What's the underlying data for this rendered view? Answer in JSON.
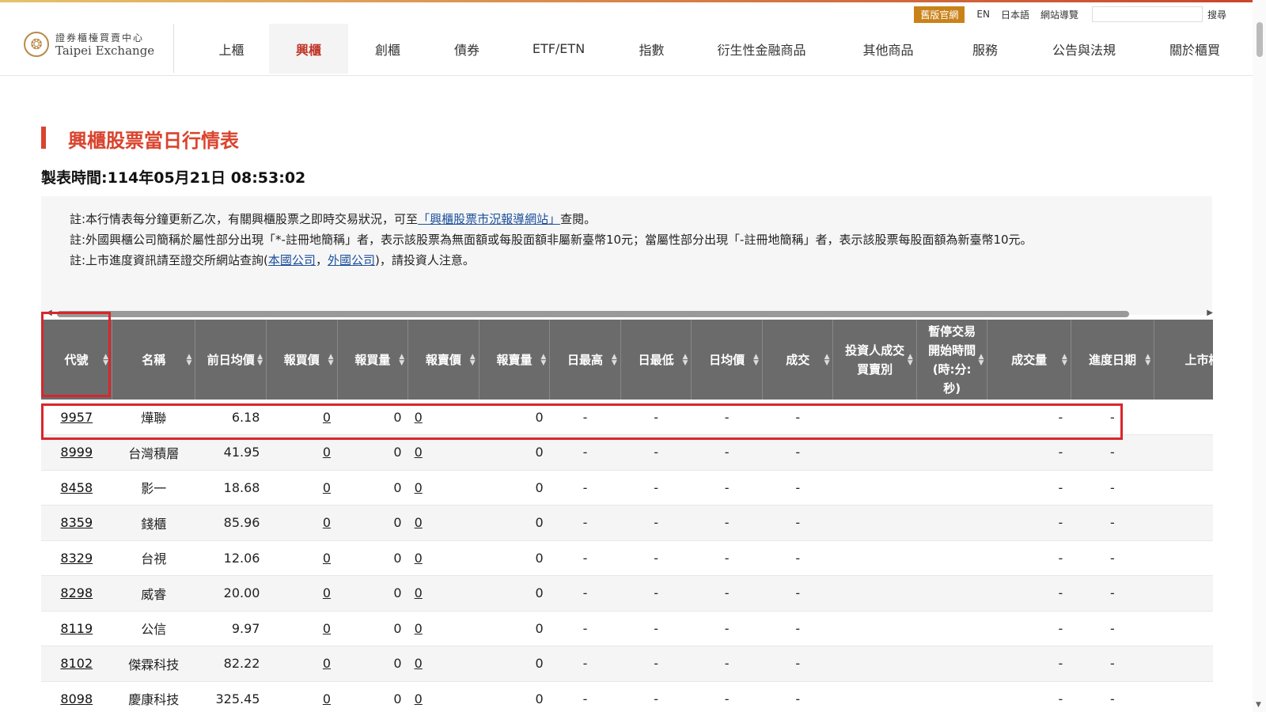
{
  "utilbar": {
    "old_site": "舊版官網",
    "links": [
      "EN",
      "日本語",
      "網站導覽"
    ],
    "search_label": "搜尋"
  },
  "logo": {
    "zh": "證券櫃檯買賣中心",
    "en": "Taipei Exchange"
  },
  "nav": {
    "items": [
      "上櫃",
      "興櫃",
      "創櫃",
      "債券",
      "ETF/ETN",
      "指數",
      "衍生性金融商品",
      "其他商品",
      "服務",
      "公告與法規",
      "關於櫃買"
    ],
    "active": "興櫃"
  },
  "page": {
    "title": "興櫃股票當日行情表",
    "timestamp": "製表時間:114年05月21日 08:53:02"
  },
  "notes": {
    "n1_pre": "註:本行情表每分鐘更新乙次，有關興櫃股票之即時交易狀況，可至",
    "n1_link": "「興櫃股票市況報導網站」",
    "n1_post": "查閱。",
    "n2": "註:外國興櫃公司簡稱於屬性部分出現「*-註冊地簡稱」者，表示該股票為無面額或每股面額非屬新臺幣10元；當屬性部分出現「-註冊地簡稱」者，表示該股票每股面額為新臺幣10元。",
    "n3_pre": "註:上市進度資訊請至證交所網站查詢(",
    "n3_link1": "本國公司",
    "n3_sep": "，",
    "n3_link2": "外國公司",
    "n3_post": ")，請投資人注意。"
  },
  "table": {
    "headers": [
      "代號",
      "名稱",
      "前日均價",
      "報買價",
      "報買量",
      "報賣價",
      "報賣量",
      "日最高",
      "日最低",
      "日均價",
      "成交",
      "投資人成交買賣別",
      "暫停交易開始時間(時:分:秒)",
      "成交量",
      "進度日期",
      "上市櫃進度"
    ],
    "rows": [
      {
        "code": "9957",
        "name": "燁聯",
        "prev": "6.18",
        "bid": "0",
        "bidv": "0",
        "ask": "0",
        "askv": "0",
        "high": "-",
        "low": "-",
        "avg": "-",
        "last": "-",
        "side": "",
        "halt": "",
        "vol": "-",
        "date": "-"
      },
      {
        "code": "8999",
        "name": "台灣積層",
        "prev": "41.95",
        "bid": "0",
        "bidv": "0",
        "ask": "0",
        "askv": "0",
        "high": "-",
        "low": "-",
        "avg": "-",
        "last": "-",
        "side": "",
        "halt": "",
        "vol": "-",
        "date": "-"
      },
      {
        "code": "8458",
        "name": "影一",
        "prev": "18.68",
        "bid": "0",
        "bidv": "0",
        "ask": "0",
        "askv": "0",
        "high": "-",
        "low": "-",
        "avg": "-",
        "last": "-",
        "side": "",
        "halt": "",
        "vol": "-",
        "date": "-"
      },
      {
        "code": "8359",
        "name": "錢櫃",
        "prev": "85.96",
        "bid": "0",
        "bidv": "0",
        "ask": "0",
        "askv": "0",
        "high": "-",
        "low": "-",
        "avg": "-",
        "last": "-",
        "side": "",
        "halt": "",
        "vol": "-",
        "date": "-"
      },
      {
        "code": "8329",
        "name": "台視",
        "prev": "12.06",
        "bid": "0",
        "bidv": "0",
        "ask": "0",
        "askv": "0",
        "high": "-",
        "low": "-",
        "avg": "-",
        "last": "-",
        "side": "",
        "halt": "",
        "vol": "-",
        "date": "-"
      },
      {
        "code": "8298",
        "name": "威睿",
        "prev": "20.00",
        "bid": "0",
        "bidv": "0",
        "ask": "0",
        "askv": "0",
        "high": "-",
        "low": "-",
        "avg": "-",
        "last": "-",
        "side": "",
        "halt": "",
        "vol": "-",
        "date": "-"
      },
      {
        "code": "8119",
        "name": "公信",
        "prev": "9.97",
        "bid": "0",
        "bidv": "0",
        "ask": "0",
        "askv": "0",
        "high": "-",
        "low": "-",
        "avg": "-",
        "last": "-",
        "side": "",
        "halt": "",
        "vol": "-",
        "date": "-"
      },
      {
        "code": "8102",
        "name": "傑霖科技",
        "prev": "82.22",
        "bid": "0",
        "bidv": "0",
        "ask": "0",
        "askv": "0",
        "high": "-",
        "low": "-",
        "avg": "-",
        "last": "-",
        "side": "",
        "halt": "",
        "vol": "-",
        "date": "-"
      },
      {
        "code": "8098",
        "name": "慶康科技",
        "prev": "325.45",
        "bid": "0",
        "bidv": "0",
        "ask": "0",
        "askv": "0",
        "high": "-",
        "low": "-",
        "avg": "-",
        "last": "-",
        "side": "",
        "halt": "",
        "vol": "-",
        "date": "-"
      }
    ]
  },
  "colors": {
    "accent": "#d9442e",
    "header_bg": "#6b6b6b",
    "highlight": "#d9262b",
    "link": "#1a4f9c"
  },
  "icons": [
    "logo-emblem-icon",
    "sort-icon",
    "scroll-left-arrow-icon",
    "scroll-right-arrow-icon",
    "scroll-down-arrow-icon"
  ]
}
